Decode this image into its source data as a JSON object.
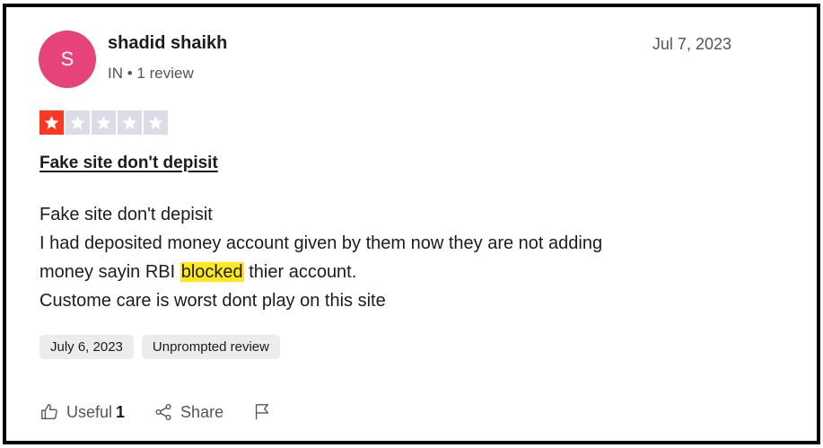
{
  "reviewer": {
    "initial": "S",
    "name": "shadid shaikh",
    "country": "IN",
    "separator": "•",
    "review_count": "1 review",
    "avatar_color": "#e6437a"
  },
  "published_date": "Jul 7, 2023",
  "rating": {
    "value": 1,
    "max": 5,
    "on_color": "#ff3722",
    "off_color": "#dcdce6"
  },
  "review": {
    "title": "Fake site don't depisit",
    "line1": "Fake site don't depisit",
    "line2": "I had deposited money account given by them now they are not adding",
    "line3_before": "money sayin RBI ",
    "line3_highlight": "blocked",
    "line3_after": " thier account.",
    "line4": "Custome care is worst dont play on this site",
    "highlight_color": "#ffe81c"
  },
  "chips": {
    "experience_date": "July 6, 2023",
    "review_type": "Unprompted review"
  },
  "actions": {
    "useful_label": "Useful",
    "useful_count": "1",
    "share_label": "Share",
    "icons": [
      "thumbs-up-icon",
      "share-icon",
      "flag-icon"
    ]
  }
}
